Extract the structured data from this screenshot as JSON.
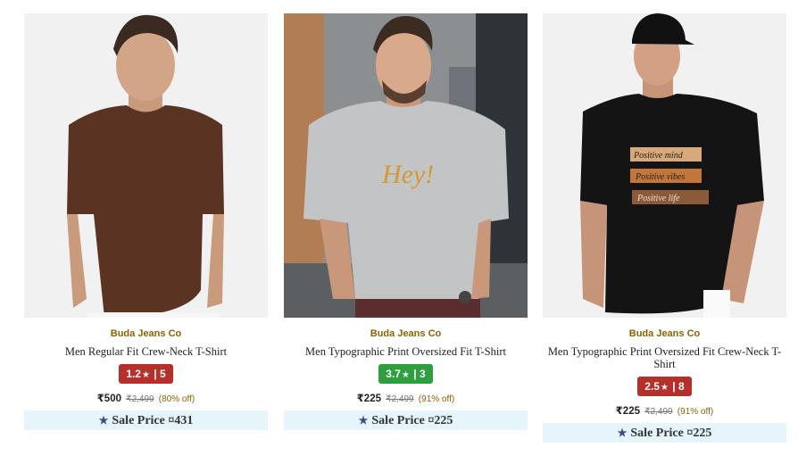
{
  "products": [
    {
      "brand": "Buda Jeans Co",
      "title": "Men Regular Fit Crew-Neck T-Shirt",
      "rating": "1.2",
      "reviews": "5",
      "rating_color": "#b5302a",
      "price": "₹500",
      "mrp": "₹2,499",
      "discount": "(80% off)",
      "sale_label": "Sale Price ¤431",
      "image": "model-brown-tshirt"
    },
    {
      "brand": "Buda Jeans Co",
      "title": "Men Typographic Print Oversized Fit T-Shirt",
      "rating": "3.7",
      "reviews": "3",
      "rating_color": "#2e9e3e",
      "price": "₹225",
      "mrp": "₹2,499",
      "discount": "(91% off)",
      "sale_label": "Sale Price ¤225",
      "image": "model-grey-hey-tshirt",
      "print_text": "Hey!"
    },
    {
      "brand": "Buda Jeans Co",
      "title": "Men Typographic Print Oversized Fit Crew-Neck T-Shirt",
      "rating": "2.5",
      "reviews": "8",
      "rating_color": "#b5302a",
      "price": "₹225",
      "mrp": "₹2,499",
      "discount": "(91% off)",
      "sale_label": "Sale Price ¤225",
      "image": "model-black-positive-tshirt",
      "print_lines": [
        "Positive mind",
        "Positive vibes",
        "Positive life"
      ]
    }
  ],
  "separator": "|",
  "star_glyph": "★"
}
